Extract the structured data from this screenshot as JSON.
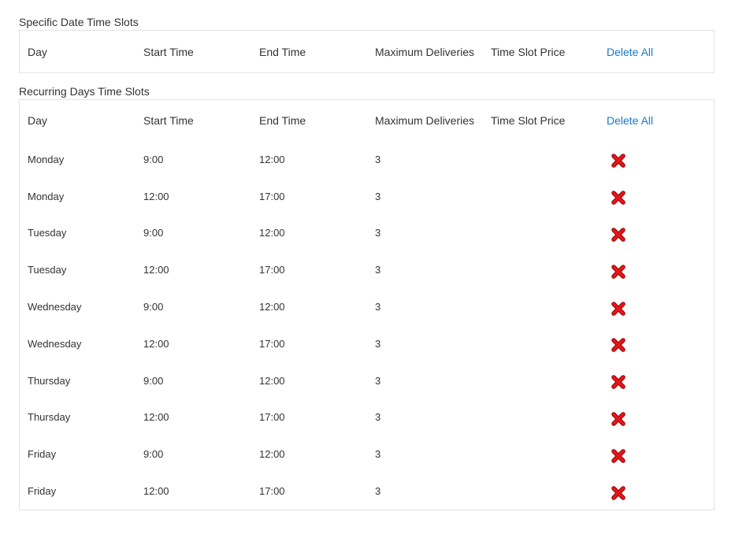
{
  "specific": {
    "title": "Specific Date Time Slots",
    "columns": {
      "day": "Day",
      "start": "Start Time",
      "end": "End Time",
      "max": "Maximum Deliveries",
      "price": "Time Slot Price",
      "delete_all": "Delete All"
    }
  },
  "recurring": {
    "title": "Recurring Days Time Slots",
    "columns": {
      "day": "Day",
      "start": "Start Time",
      "end": "End Time",
      "max": "Maximum Deliveries",
      "price": "Time Slot Price",
      "delete_all": "Delete All"
    },
    "rows": [
      {
        "day": "Monday",
        "start": "9:00",
        "end": "12:00",
        "max": "3",
        "price": ""
      },
      {
        "day": "Monday",
        "start": "12:00",
        "end": "17:00",
        "max": "3",
        "price": ""
      },
      {
        "day": "Tuesday",
        "start": "9:00",
        "end": "12:00",
        "max": "3",
        "price": ""
      },
      {
        "day": "Tuesday",
        "start": "12:00",
        "end": "17:00",
        "max": "3",
        "price": ""
      },
      {
        "day": "Wednesday",
        "start": "9:00",
        "end": "12:00",
        "max": "3",
        "price": ""
      },
      {
        "day": "Wednesday",
        "start": "12:00",
        "end": "17:00",
        "max": "3",
        "price": ""
      },
      {
        "day": "Thursday",
        "start": "9:00",
        "end": "12:00",
        "max": "3",
        "price": ""
      },
      {
        "day": "Thursday",
        "start": "12:00",
        "end": "17:00",
        "max": "3",
        "price": ""
      },
      {
        "day": "Friday",
        "start": "9:00",
        "end": "12:00",
        "max": "3",
        "price": ""
      },
      {
        "day": "Friday",
        "start": "12:00",
        "end": "17:00",
        "max": "3",
        "price": ""
      }
    ]
  },
  "icons": {
    "delete": "delete-x-icon"
  },
  "colors": {
    "link": "#1979c3",
    "delete_icon": "#e8141a",
    "border": "#e3e3e3",
    "text": "#333333"
  }
}
